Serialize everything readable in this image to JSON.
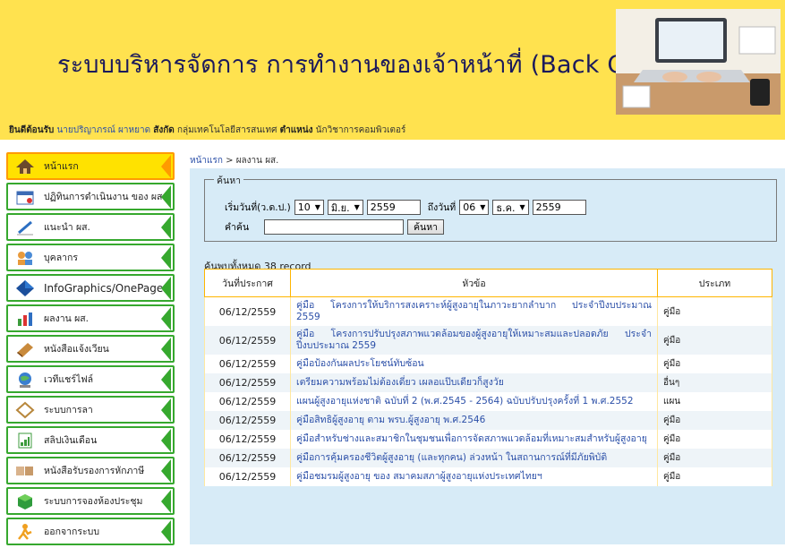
{
  "header": {
    "title": "ระบบบริหารจัดการ การทำงานของเจ้าหน้าที่ (Back Office)"
  },
  "welcome": {
    "greeting": "ยินดีต้อนรับ",
    "user": "นายปริญาภรณ์ ผาหยาด",
    "affiliation_label": "สังกัด",
    "affiliation": "กลุ่มเทคโนโลยีสารสนเทศ",
    "position_label": "ตำแหน่ง",
    "position": "นักวิชาการคอมพิวเตอร์"
  },
  "sidebar": {
    "items": [
      {
        "label": "หน้าแรก",
        "icon": "home-icon"
      },
      {
        "label": "ปฏิทินการดำเนินงาน ของ ผส.",
        "icon": "calendar-icon"
      },
      {
        "label": "แนะนำ ผส.",
        "icon": "pen-icon"
      },
      {
        "label": "บุคลากร",
        "icon": "people-icon"
      },
      {
        "label": "InfoGraphics/OnePage",
        "icon": "diamond-icon"
      },
      {
        "label": "ผลงาน ผส.",
        "icon": "chart-icon"
      },
      {
        "label": "หนังสือแจ้งเวียน",
        "icon": "book-icon"
      },
      {
        "label": "เวทีแชร์ไฟล์",
        "icon": "globe-icon"
      },
      {
        "label": "ระบบการลา",
        "icon": "tag-icon"
      },
      {
        "label": "สลิปเงินเดือน",
        "icon": "slip-icon"
      },
      {
        "label": "หนังสือรับรองการหักภาษี",
        "icon": "document-icon"
      },
      {
        "label": "ระบบการจองห้องประชุม",
        "icon": "cube-icon"
      },
      {
        "label": "ออกจากระบบ",
        "icon": "logout-icon"
      }
    ]
  },
  "breadcrumb": {
    "home": "หน้าแรก",
    "separator": ">",
    "current": "ผลงาน ผส."
  },
  "search": {
    "legend": "ค้นหา",
    "from_label": "เริ่มวันที่(ว.ด.ป.)",
    "from_day": "10",
    "from_month": "มิ.ย.",
    "from_year": "2559",
    "to_label": "ถึงวันที่",
    "to_day": "06",
    "to_month": "ธ.ค.",
    "to_year": "2559",
    "keyword_label": "คำค้น",
    "keyword_value": "",
    "button": "ค้นหา"
  },
  "results": {
    "count_text": "ค้นพบทั้งหมด 38 record",
    "columns": [
      "วันที่ประกาศ",
      "หัวข้อ",
      "ประเภท"
    ],
    "rows": [
      {
        "date": "06/12/2559",
        "title": "คู่มือ โครงการให้บริการสงเคราะห์ผู้สูงอายุในภาวะยากลำบาก ประจำปีงบประมาณ 2559",
        "type": "คู่มือ"
      },
      {
        "date": "06/12/2559",
        "title": "คู่มือ โครงการปรับปรุงสภาพแวดล้อมของผู้สูงอายุให้เหมาะสมและปลอดภัย ประจำปีงบประมาณ 2559",
        "type": "คู่มือ"
      },
      {
        "date": "06/12/2559",
        "title": "คู่มือป้องกันผลประโยชน์ทับซ้อน",
        "type": "คู่มือ"
      },
      {
        "date": "06/12/2559",
        "title": "เตรียมความพร้อมไม่ต้องเดี่ยว เผลอแป๊บเดียวก็สูงวัย",
        "type": "อื่นๆ"
      },
      {
        "date": "06/12/2559",
        "title": "แผนผู้สูงอายุแห่งชาติ ฉบับที่ 2 (พ.ศ.2545 - 2564) ฉบับปรับปรุงครั้งที่ 1 พ.ศ.2552",
        "type": "แผน"
      },
      {
        "date": "06/12/2559",
        "title": "คู่มือสิทธิผู้สูงอายุ ตาม พรบ.ผู้สูงอายุ พ.ศ.2546",
        "type": "คู่มือ"
      },
      {
        "date": "06/12/2559",
        "title": "คู่มือสำหรับช่างและสมาชิกในชุมชนเพื่อการจัดสภาพแวดล้อมที่เหมาะสมสำหรับผู้สูงอายุ",
        "type": "คู่มือ"
      },
      {
        "date": "06/12/2559",
        "title": "คู่มือการคุ้มครองชีวิตผู้สูงอายุ (และทุกคน) ล่วงหน้า ในสถานการณ์ที่มีภัยพิบัติ",
        "type": "คู่มือ"
      },
      {
        "date": "06/12/2559",
        "title": "คู่มือชมรมผู้สูงอายุ ของ สมาคมสภาผู้สูงอายุแห่งประเทศไทยฯ",
        "type": "คู่มือ"
      }
    ]
  },
  "colors": {
    "banner_yellow": "#ffe24f",
    "sidebar_border": "#36a82e",
    "active_item": "#ffe200",
    "link_blue": "#2b4fa8",
    "panel_bg": "#d7ebf7",
    "table_border": "#ffb500"
  }
}
